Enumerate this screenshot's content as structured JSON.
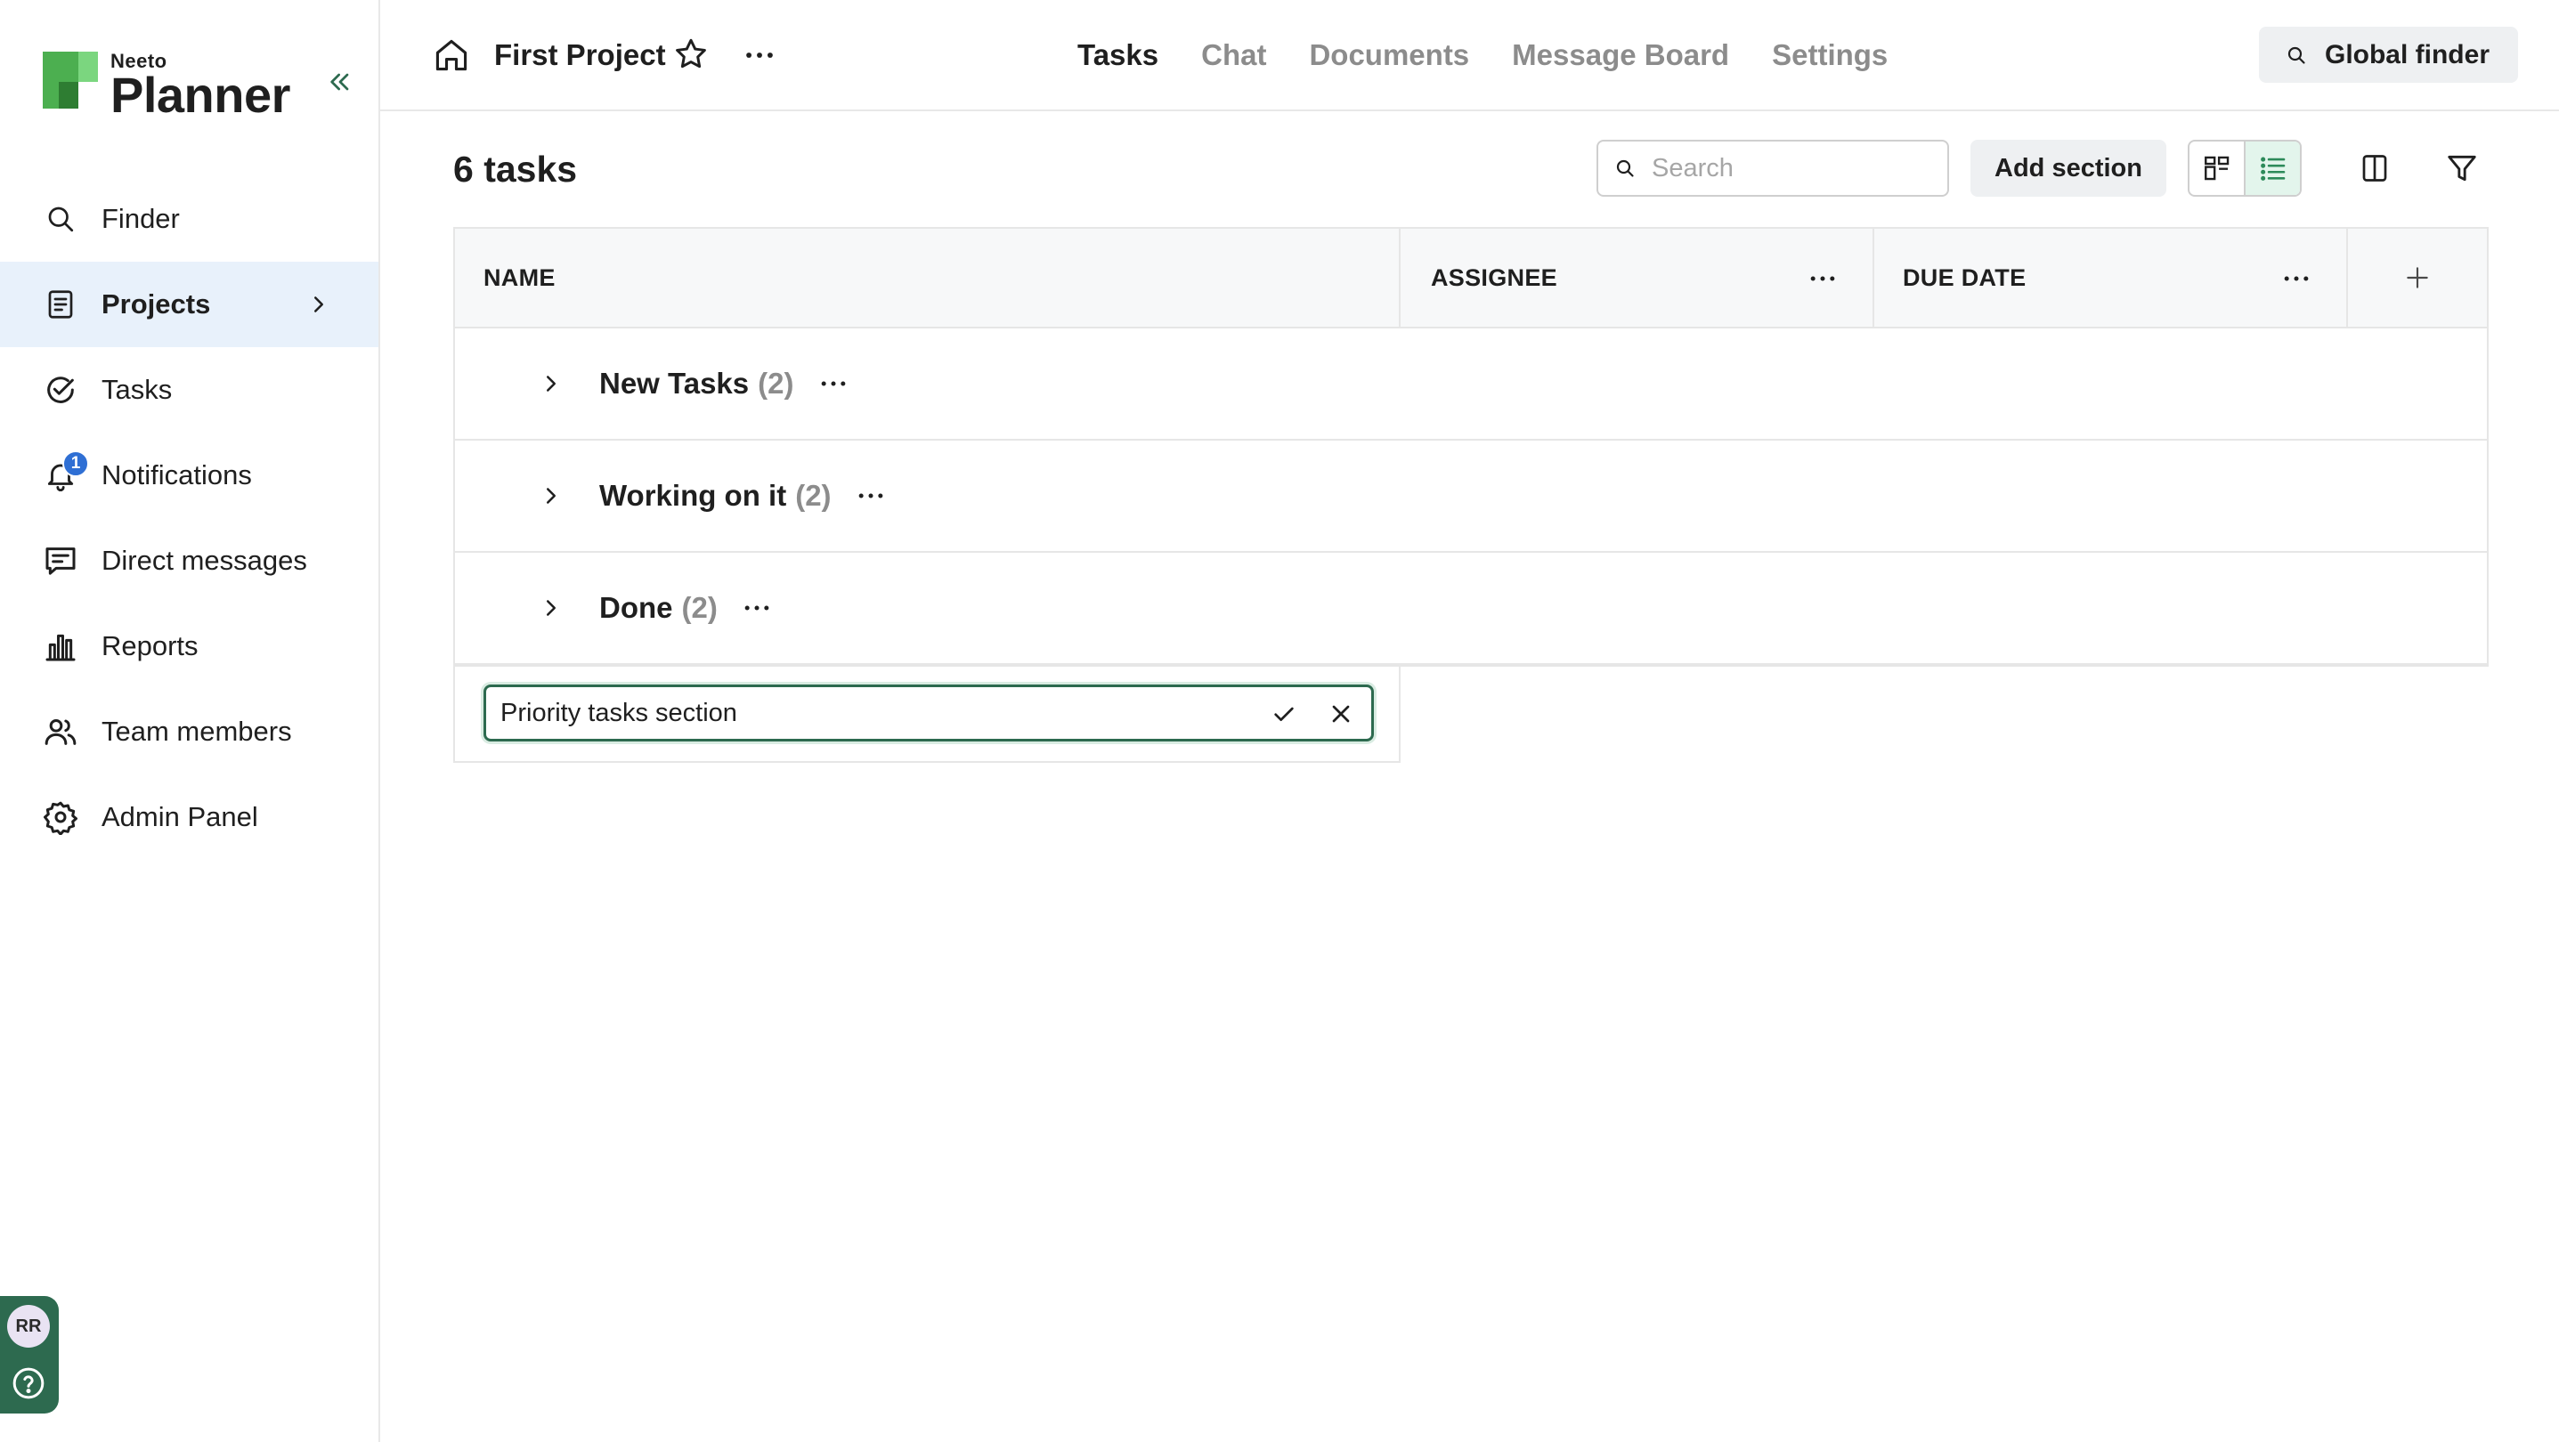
{
  "brand": {
    "small": "Neeto",
    "big": "Planner",
    "accent": "#4caf50"
  },
  "sidebar": {
    "items": [
      {
        "label": "Finder",
        "icon": "search-icon"
      },
      {
        "label": "Projects",
        "icon": "projects-icon",
        "active": true
      },
      {
        "label": "Tasks",
        "icon": "check-circle-icon"
      },
      {
        "label": "Notifications",
        "icon": "bell-icon",
        "badge": "1"
      },
      {
        "label": "Direct messages",
        "icon": "message-icon"
      },
      {
        "label": "Reports",
        "icon": "bar-chart-icon"
      },
      {
        "label": "Team members",
        "icon": "users-icon"
      },
      {
        "label": "Admin Panel",
        "icon": "gear-icon"
      }
    ],
    "user_initials": "RR"
  },
  "header": {
    "project_title": "First Project",
    "tabs": [
      {
        "label": "Tasks",
        "active": true
      },
      {
        "label": "Chat"
      },
      {
        "label": "Documents"
      },
      {
        "label": "Message Board"
      },
      {
        "label": "Settings"
      }
    ],
    "global_finder_label": "Global finder"
  },
  "toolbar": {
    "task_count": "6 tasks",
    "search_placeholder": "Search",
    "add_section_label": "Add section"
  },
  "table": {
    "columns": [
      "NAME",
      "ASSIGNEE",
      "DUE DATE"
    ],
    "sections": [
      {
        "name": "New Tasks",
        "count": "(2)"
      },
      {
        "name": "Working on it",
        "count": "(2)"
      },
      {
        "name": "Done",
        "count": "(2)"
      }
    ],
    "new_section_value": "Priority tasks section"
  }
}
